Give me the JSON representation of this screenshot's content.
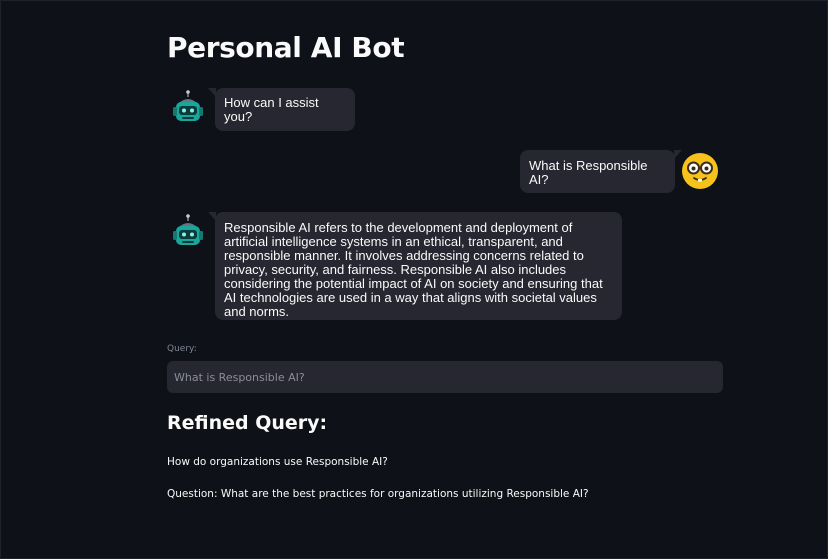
{
  "page": {
    "title": "Personal AI Bot"
  },
  "chat": {
    "messages": [
      {
        "role": "assistant",
        "avatar": "robot-icon",
        "text": "How can I assist you?"
      },
      {
        "role": "user",
        "avatar": "nerd-face-icon",
        "text": "What is Responsible AI?"
      },
      {
        "role": "assistant",
        "avatar": "robot-icon",
        "text": "Responsible AI refers to the development and deployment of artificial intelligence systems in an ethical, transparent, and responsible manner. It involves addressing concerns related to privacy, security, and fairness. Responsible AI also includes considering the potential impact of AI on society and ensuring that AI technologies are used in a way that aligns with societal values and norms."
      }
    ]
  },
  "query": {
    "label": "Query:",
    "placeholder": "What is Responsible AI?",
    "value": ""
  },
  "refined": {
    "heading": "Refined Query:",
    "lines": [
      "How do organizations use Responsible AI?",
      "Question: What are the best practices for organizations utilizing Responsible AI?"
    ]
  },
  "colors": {
    "background": "#0e1117",
    "bubble": "#262730",
    "text": "#fafafa",
    "muted": "#808495",
    "robot": "#1aa79b",
    "emoji": "#f8c21c"
  }
}
